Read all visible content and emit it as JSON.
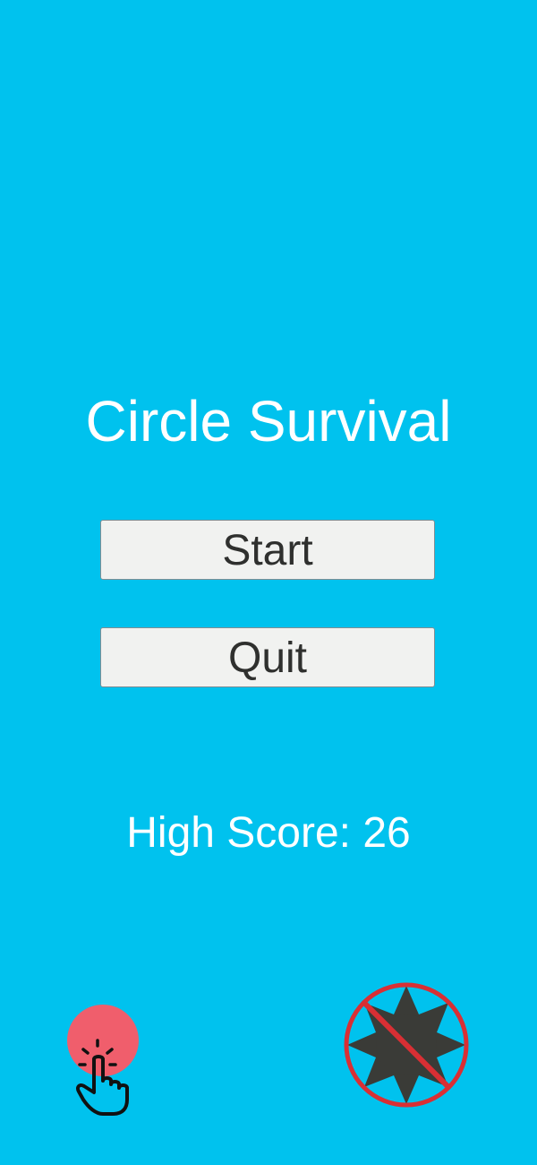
{
  "game": {
    "title": "Circle Survival"
  },
  "menu": {
    "start_label": "Start",
    "quit_label": "Quit"
  },
  "score": {
    "label": "High Score:",
    "value": 26,
    "text": "High Score: 26"
  },
  "hints": {
    "tap_icon": "tap-circle-icon",
    "avoid_icon": "no-spiked-mine-icon"
  },
  "colors": {
    "background": "#00c2ee",
    "button_fill": "#f1f2f0",
    "button_text": "#2f302e",
    "tap_circle": "#f05e6c",
    "mine": "#3a3b37",
    "prohibition": "#d92f34"
  }
}
